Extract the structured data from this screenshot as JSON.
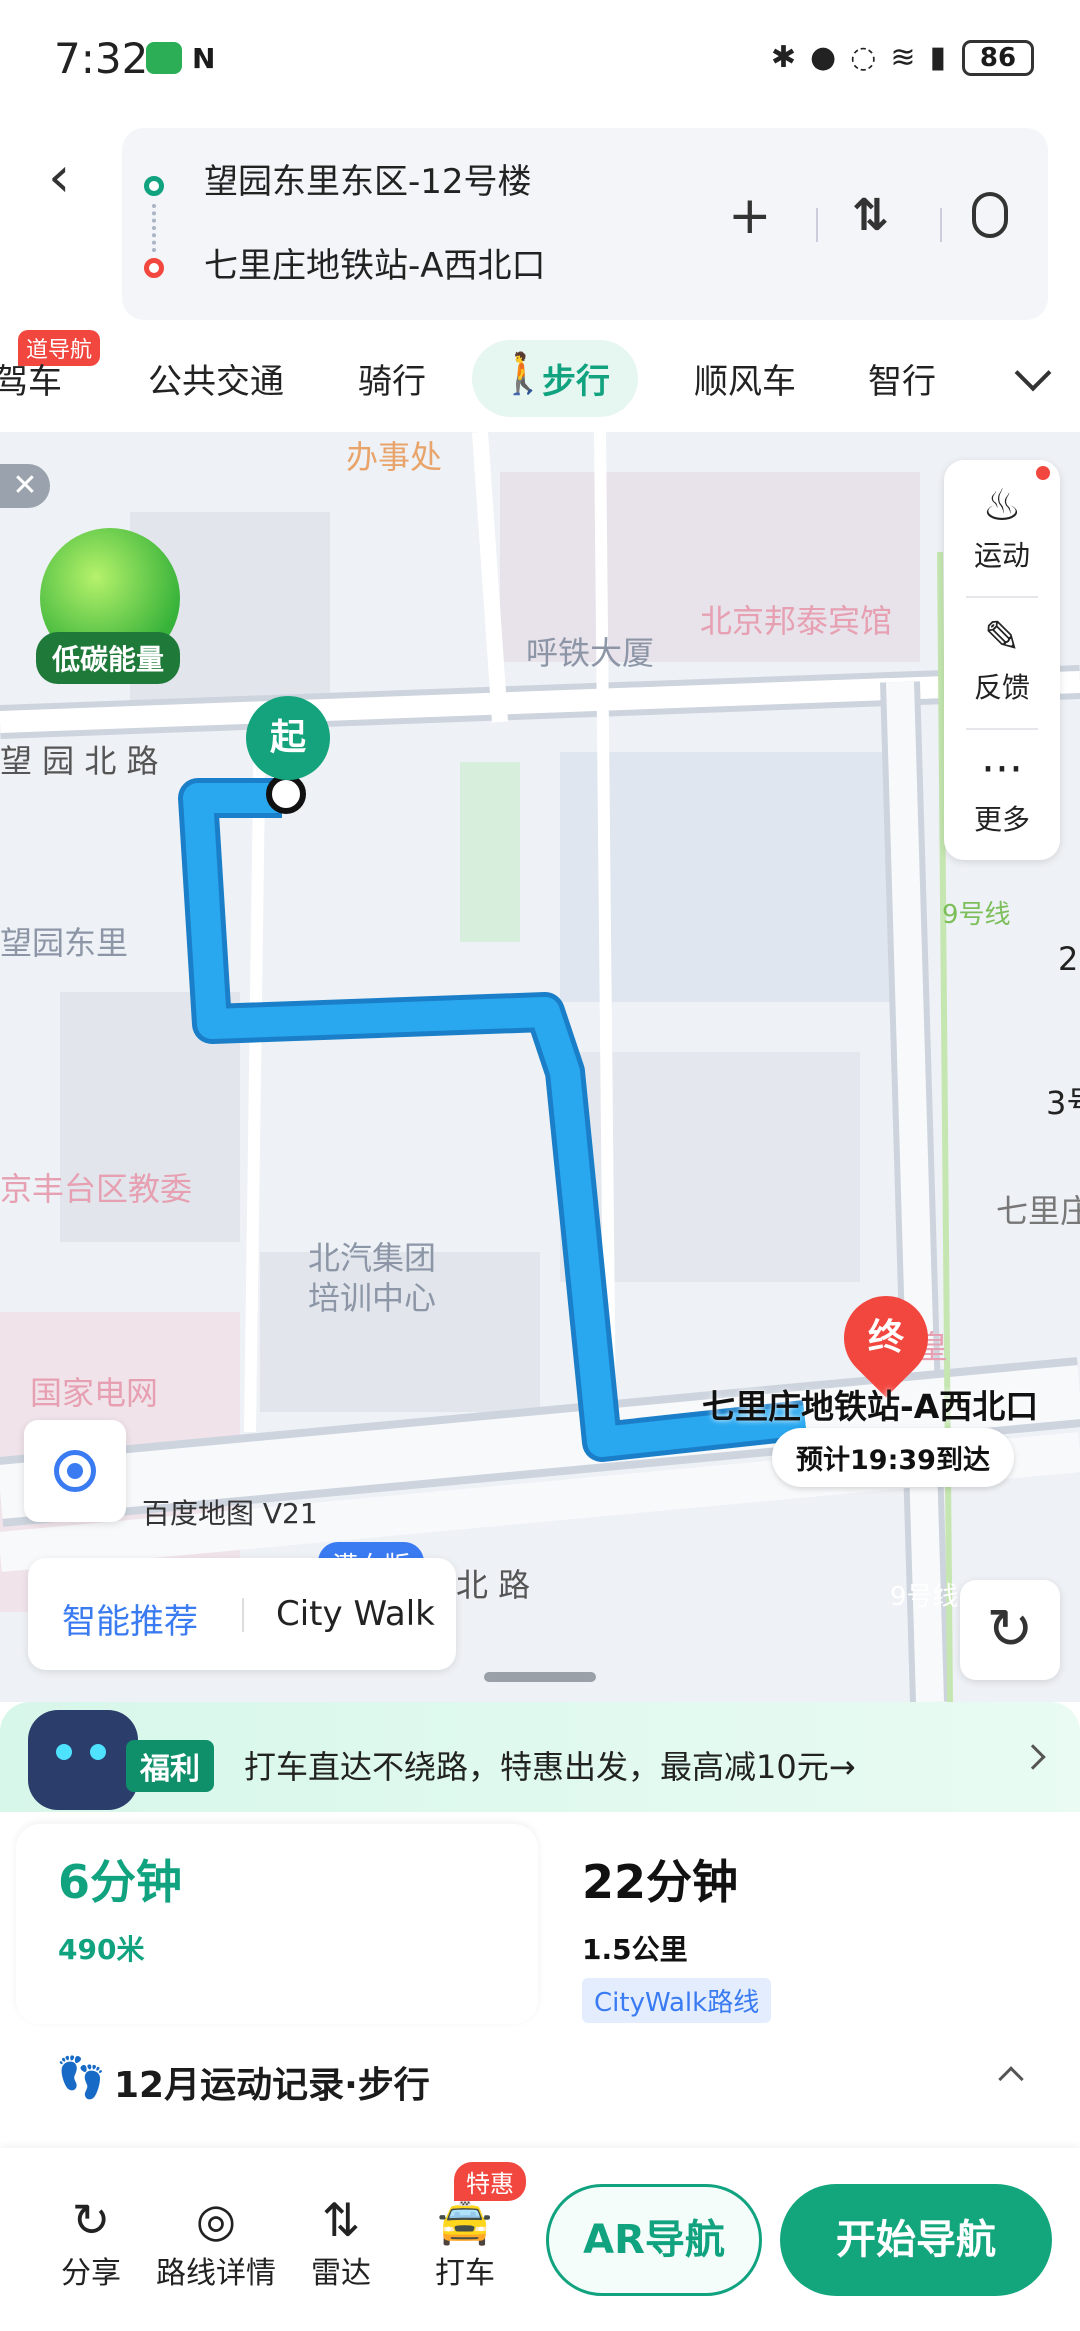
{
  "status_bar": {
    "time": "7:32",
    "battery": "86"
  },
  "route": {
    "origin": "望园东里东区-12号楼",
    "destination": "七里庄地铁站-A西北口"
  },
  "mode_tabs": {
    "badge": "道导航",
    "items": [
      {
        "label": "驾车"
      },
      {
        "label": "公共交通"
      },
      {
        "label": "骑行"
      },
      {
        "label": "步行",
        "active": true
      },
      {
        "label": "顺风车"
      },
      {
        "label": "智行"
      }
    ]
  },
  "map": {
    "labels": {
      "banshichu": "办事处",
      "hutie": "呼铁大厦",
      "bangtai": "北京邦泰宾馆",
      "wangyuanbeilu": "望 园 北 路",
      "wangyuandongli": "望园东里",
      "fengtai": "京丰台区教委",
      "beiqi": "北汽集团\n培训中心",
      "guojia": "国家电网",
      "line9a": "9号线",
      "line9b": "9号线",
      "qili": "七里庄",
      "beilu": "北 路",
      "huang": "皇",
      "edge2": "2",
      "edge3": "3号"
    },
    "eco_label": "低碳能量",
    "side_panel": [
      {
        "label": "运动",
        "icon": "flame-icon"
      },
      {
        "label": "反馈",
        "icon": "pencil-icon"
      },
      {
        "label": "更多",
        "icon": "more-icon"
      }
    ],
    "logo": "百度地图 V21",
    "recommend": {
      "smart": "智能推荐",
      "citywalk": "City Walk",
      "badge": "满血版"
    },
    "start_pin": "起",
    "end_pin": "终",
    "destination_label": "七里庄地铁站-A西北口",
    "eta": "预计19:39到达"
  },
  "promo": {
    "badge": "福利",
    "text": "打车直达不绕路，特惠出发，最高减10元→"
  },
  "route_options": [
    {
      "duration": "6分钟",
      "distance": "490米",
      "selected": true
    },
    {
      "duration": "22分钟",
      "distance": "1.5公里",
      "tag": "CityWalk路线"
    }
  ],
  "record": {
    "title": "12月运动记录·步行"
  },
  "bottom_bar": {
    "items": [
      {
        "label": "分享",
        "icon": "share-icon"
      },
      {
        "label": "路线详情",
        "icon": "location-pin-icon"
      },
      {
        "label": "雷达",
        "icon": "radar-icon"
      },
      {
        "label": "打车",
        "icon": "taxi-icon"
      }
    ],
    "sale_badge": "特惠",
    "ar_button": "AR导航",
    "start_button": "开始导航"
  },
  "colors": {
    "accent": "#11a37f",
    "route": "#29a8f0",
    "end": "#f2473f",
    "link": "#3a7bf2"
  }
}
